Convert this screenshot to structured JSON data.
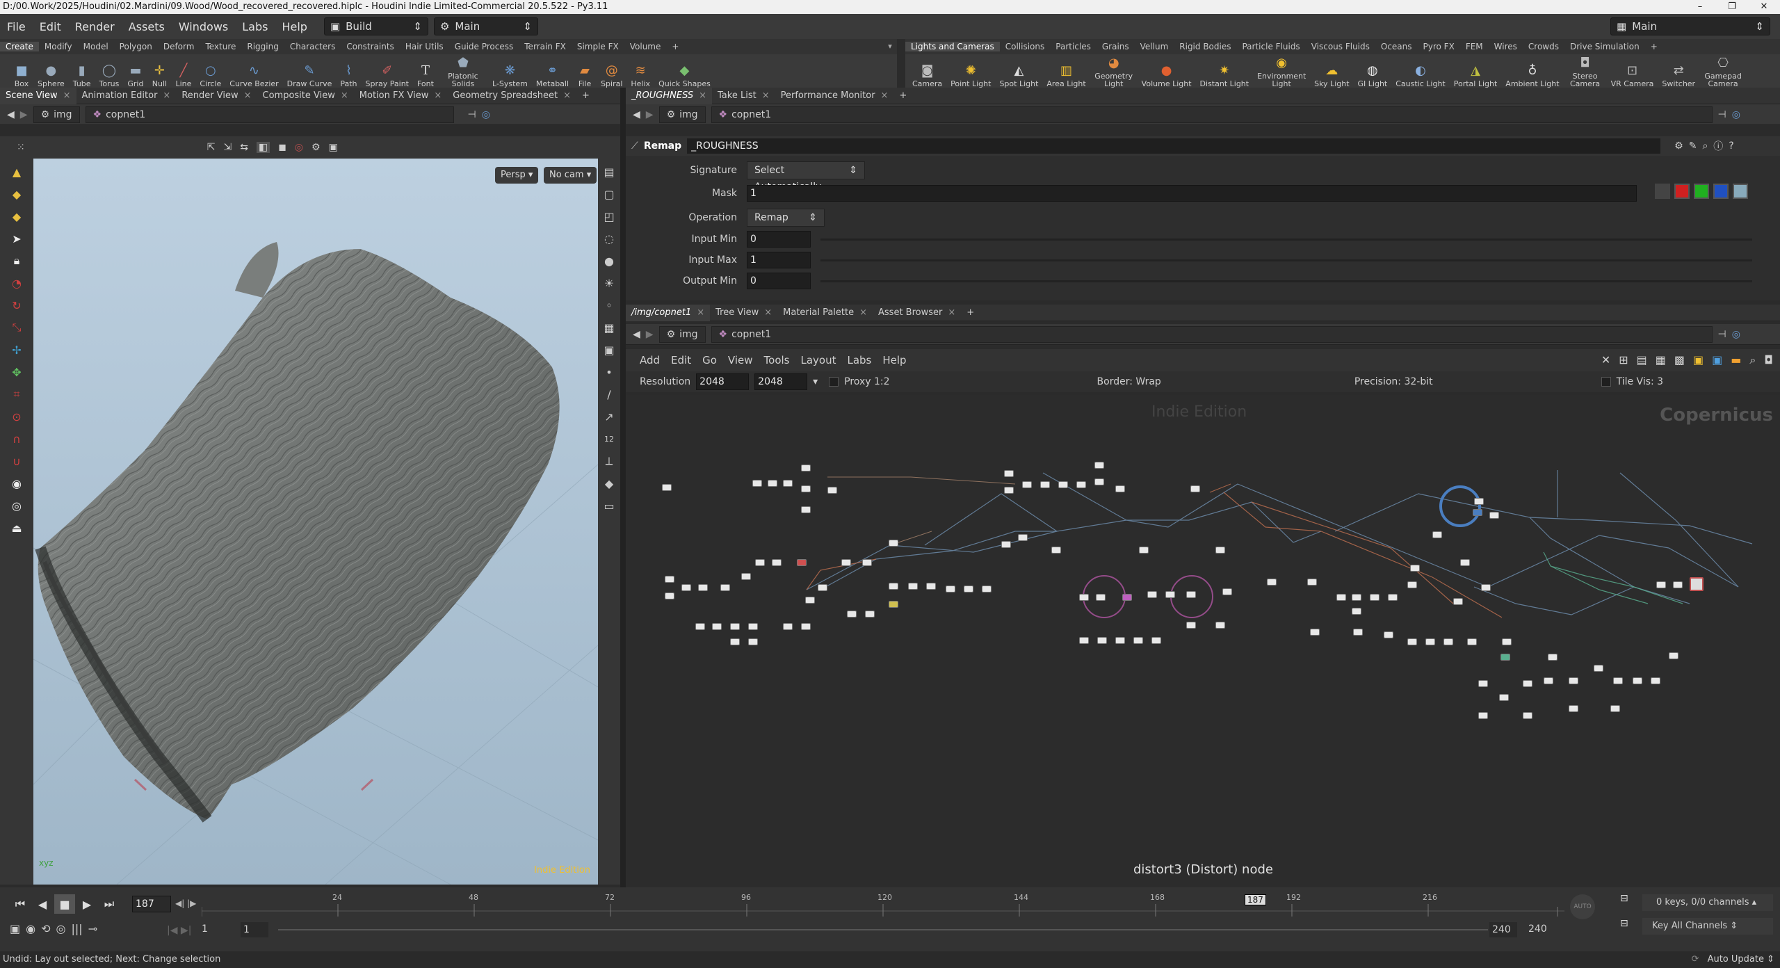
{
  "window": {
    "title": "D:/00.Work/2025/Houdini/02.Mardini/09.Wood/Wood_recovered_recovered.hiplc - Houdini Indie Limited-Commercial 20.5.522 - Py3.11",
    "min": "–",
    "max": "▢",
    "restore": "❐",
    "close": "✕"
  },
  "menubar": {
    "items": [
      "File",
      "Edit",
      "Render",
      "Assets",
      "Windows",
      "Labs",
      "Help"
    ],
    "desktop": "Build",
    "context": "Main",
    "right_desktop": "Main"
  },
  "shelf_left": {
    "tabs": [
      "Create",
      "Modify",
      "Model",
      "Polygon",
      "Deform",
      "Texture",
      "Rigging",
      "Characters",
      "Constraints",
      "Hair Utils",
      "Guide Process",
      "Terrain FX",
      "Simple FX",
      "Volume"
    ],
    "active_tab": "Create",
    "tools": [
      "Box",
      "Sphere",
      "Tube",
      "Torus",
      "Grid",
      "Null",
      "Line",
      "Circle",
      "Curve Bezier",
      "Draw Curve",
      "Path",
      "Spray Paint",
      "Font",
      "Platonic Solids",
      "L-System",
      "Metaball",
      "File",
      "Spiral",
      "Helix",
      "Quick Shapes"
    ]
  },
  "shelf_right": {
    "tabs": [
      "Lights and Cameras",
      "Collisions",
      "Particles",
      "Grains",
      "Vellum",
      "Rigid Bodies",
      "Particle Fluids",
      "Viscous Fluids",
      "Oceans",
      "Pyro FX",
      "FEM",
      "Wires",
      "Crowds",
      "Drive Simulation"
    ],
    "active_tab": "Lights and Cameras",
    "tools": [
      "Camera",
      "Point Light",
      "Spot Light",
      "Area Light",
      "Geometry Light",
      "Volume Light",
      "Distant Light",
      "Environment Light",
      "Sky Light",
      "GI Light",
      "Caustic Light",
      "Portal Light",
      "Ambient Light",
      "Stereo Camera",
      "VR Camera",
      "Switcher",
      "Gamepad Camera"
    ]
  },
  "left_pane": {
    "tabs": [
      "Scene View",
      "Animation Editor",
      "Render View",
      "Composite View",
      "Motion FX View",
      "Geometry Spreadsheet"
    ],
    "path_root": "img",
    "path_node": "copnet1",
    "persp": "Persp",
    "cam": "No cam",
    "watermark": "Indie Edition"
  },
  "param_pane": {
    "tabs": [
      "_ROUGHNESS",
      "Take List",
      "Performance Monitor"
    ],
    "path_root": "img",
    "path_node": "copnet1",
    "node_type": "Remap",
    "node_name": "_ROUGHNESS",
    "params": [
      {
        "label": "Signature",
        "value": "Select Automatically"
      },
      {
        "label": "Mask",
        "value": "1"
      },
      {
        "label": "Operation",
        "value": "Remap"
      },
      {
        "label": "Input Min",
        "value": "0"
      },
      {
        "label": "Input Max",
        "value": "1"
      },
      {
        "label": "Output Min",
        "value": "0"
      }
    ]
  },
  "network_pane": {
    "tabs": [
      "/img/copnet1",
      "Tree View",
      "Material Palette",
      "Asset Browser"
    ],
    "path_root": "img",
    "path_node": "copnet1",
    "menu": [
      "Add",
      "Edit",
      "Go",
      "View",
      "Tools",
      "Layout",
      "Labs",
      "Help"
    ],
    "resolution_label": "Resolution",
    "res_x": "2048",
    "res_y": "2048",
    "proxy": "Proxy 1:2",
    "border": "Border: Wrap",
    "precision": "Precision: 32-bit",
    "tile_vis": "Tile Vis: 3",
    "watermark": "Indie Edition",
    "context_label": "Copernicus",
    "status": "distort3 (Distort) node"
  },
  "timeline": {
    "current_frame": "187",
    "ticks": [
      "24",
      "48",
      "72",
      "96",
      "120",
      "144",
      "168",
      "192",
      "216"
    ],
    "playhead_marker": "187",
    "start": "1",
    "start2": "1",
    "end": "240",
    "end2": "240",
    "keys": "0 keys, 0/0 channels",
    "key_all": "Key All Channels",
    "auto_update": "Auto Update"
  },
  "statusbar": {
    "text": "Undid: Lay out selected; Next: Change selection"
  }
}
